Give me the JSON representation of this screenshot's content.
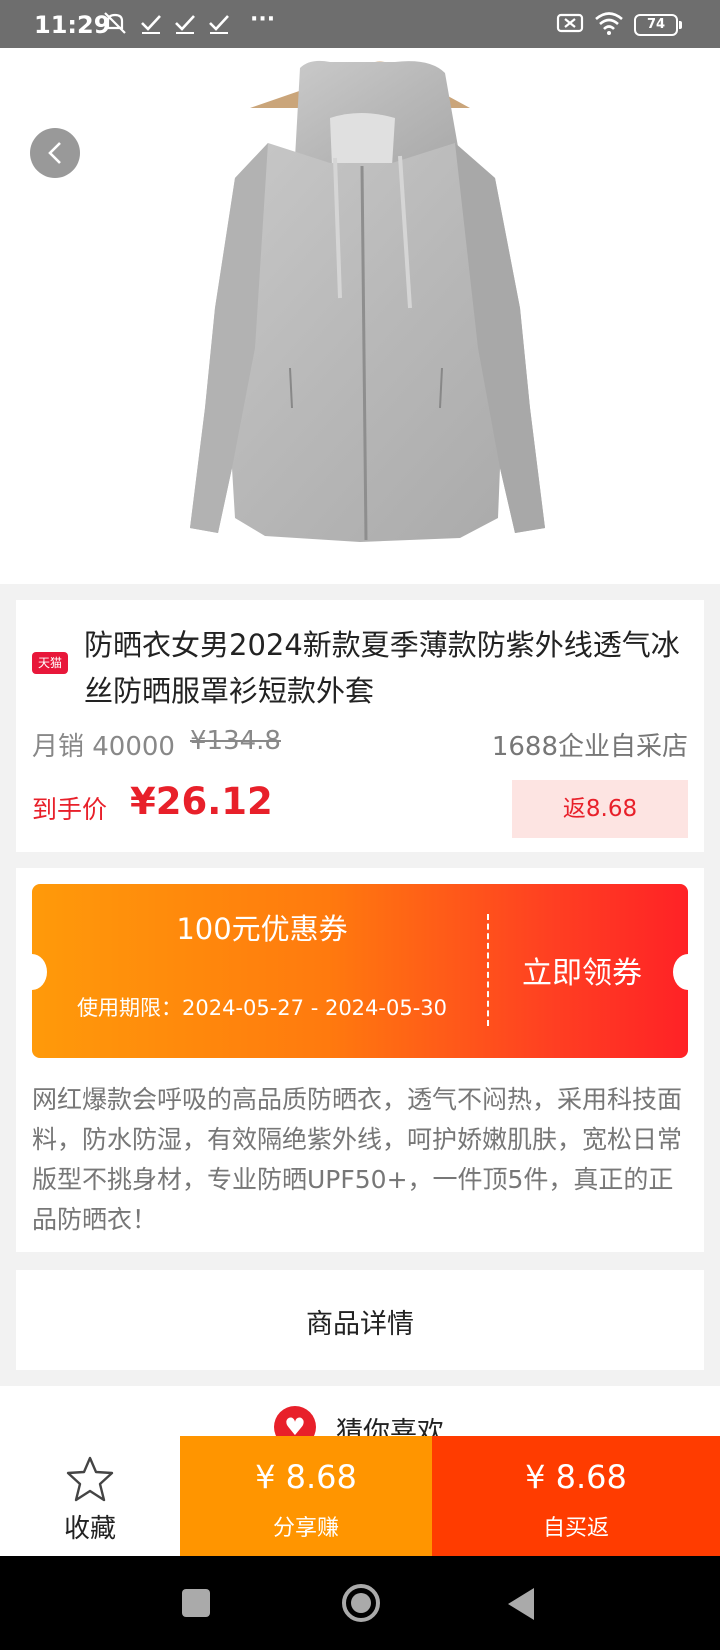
{
  "status_bar": {
    "time": "11:29",
    "battery": "74",
    "icons": [
      "mute-icon",
      "check-icon",
      "check-icon",
      "check-icon",
      "more-icon",
      "sim-off-icon",
      "wifi-icon",
      "battery-icon"
    ]
  },
  "hero": {
    "image": "gray-hooded-sun-protection-jacket-photo",
    "back_icon": "chevron-left-icon"
  },
  "product": {
    "platform_badge": "天猫",
    "title": "防晒衣女男2024新款夏季薄款防紫外线透气冰丝防晒服罩衫短款外套",
    "monthly_sales": "月销 40000",
    "original_price": "¥134.8",
    "shop_name": "1688企业自采店",
    "final_price_label": "到手价",
    "final_price": "¥26.12",
    "rebate": "返8.68"
  },
  "coupon": {
    "amount": "100元优惠券",
    "validity": "使用期限：2024-05-27 - 2024-05-30",
    "button": "立即领券"
  },
  "description": "网红爆款会呼吸的高品质防晒衣，透气不闷热，采用科技面料，防水防湿，有效隔绝紫外线，呵护娇嫩肌肤，宽松日常版型不挑身材，专业防晒UPF50+，一件顶5件，真正的正品防晒衣！",
  "detail_section": "商品详情",
  "guess_section": "猜你喜欢",
  "bottom_bar": {
    "favorite_label": "收藏",
    "share_amount": "¥ 8.68",
    "share_label": "分享赚",
    "buy_amount": "¥ 8.68",
    "buy_label": "自买返"
  },
  "colors": {
    "accent_red": "#e8202a",
    "share_orange": "#ff9500",
    "buy_red": "#ff3c00",
    "coupon_gradient": [
      "#ff9a0a",
      "#ff2226"
    ]
  }
}
